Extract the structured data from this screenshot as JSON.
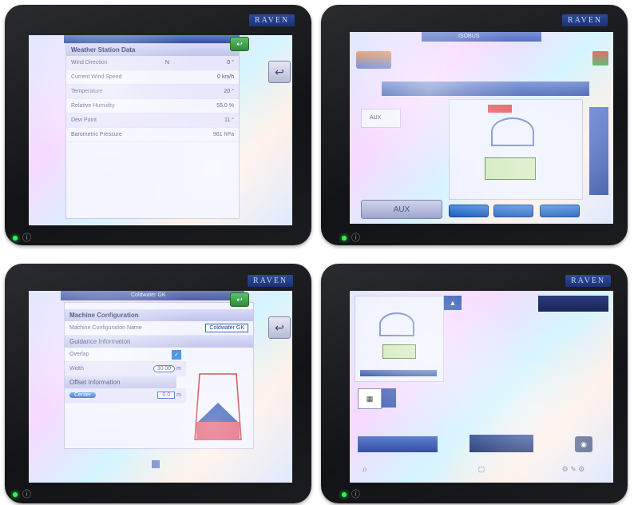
{
  "brand": "RAVEN",
  "q1": {
    "panel_title": "Weather Station Data",
    "rows": [
      {
        "label": "Wind Direction",
        "mid": "N",
        "value": "0 °"
      },
      {
        "label": "Current Wind Speed",
        "mid": "",
        "value": "0 km/h"
      },
      {
        "label": "Temperature",
        "mid": "",
        "value": "20 °"
      },
      {
        "label": "Relative Humidity",
        "mid": "",
        "value": "55.0 %"
      },
      {
        "label": "Dew Point",
        "mid": "",
        "value": "11 °"
      },
      {
        "label": "Barometric Pressure",
        "mid": "",
        "value": "981 hPa"
      }
    ]
  },
  "q2": {
    "title": "ISOBUS",
    "aux_label": "AUX",
    "box_label": "AUX"
  },
  "q3": {
    "top_title": "Coldwater GK",
    "panel_title": "Machine Configuration",
    "config_name_label": "Machine Configuration Name",
    "config_name_value": "Coldwater GK",
    "guidance_header": "Guidance Information",
    "overlap_label": "Overlap",
    "width_label": "Width",
    "width_value": "30.00",
    "width_unit": "m",
    "offset_header": "Offset Information",
    "offset_mode": "Center",
    "offset_value": "0.0",
    "offset_unit": "m",
    "page_icon": "checkbox-icon"
  },
  "q4": {
    "bottom_icons": [
      "search-icon",
      "home-icon",
      "settings-icon"
    ]
  }
}
